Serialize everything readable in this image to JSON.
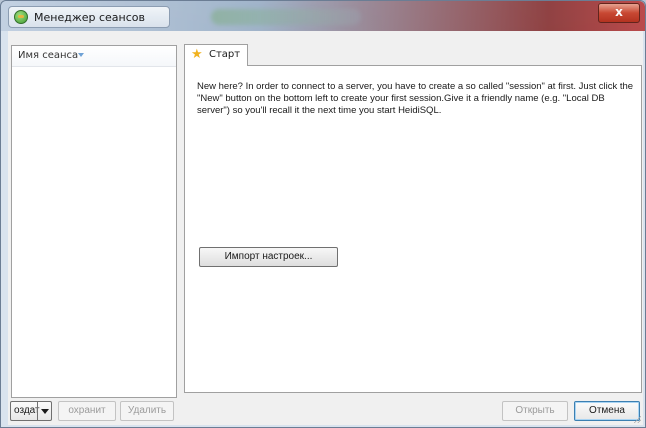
{
  "window": {
    "title": "Менеджер сеансов",
    "close_label": "x"
  },
  "session_list": {
    "column_header": "Имя сеанса"
  },
  "tabs": [
    {
      "label": "Старт",
      "icon": "star-icon"
    }
  ],
  "start_tab": {
    "intro_text": "New here? In order to connect to a server, you have to create a so called \"session\" at first. Just click the \"New\" button on the bottom left to create your first session.Give it a friendly name (e.g. \"Local DB server\") so you'll recall it the next time you start HeidiSQL.",
    "import_button": "Импорт настроек..."
  },
  "footer": {
    "new_button": "оздат",
    "save_button": "охранит",
    "delete_button": "Удалить",
    "open_button": "Открыть",
    "cancel_button": "Отмена"
  },
  "colors": {
    "accent": "#3c7fb1",
    "close_button": "#c9412a"
  }
}
